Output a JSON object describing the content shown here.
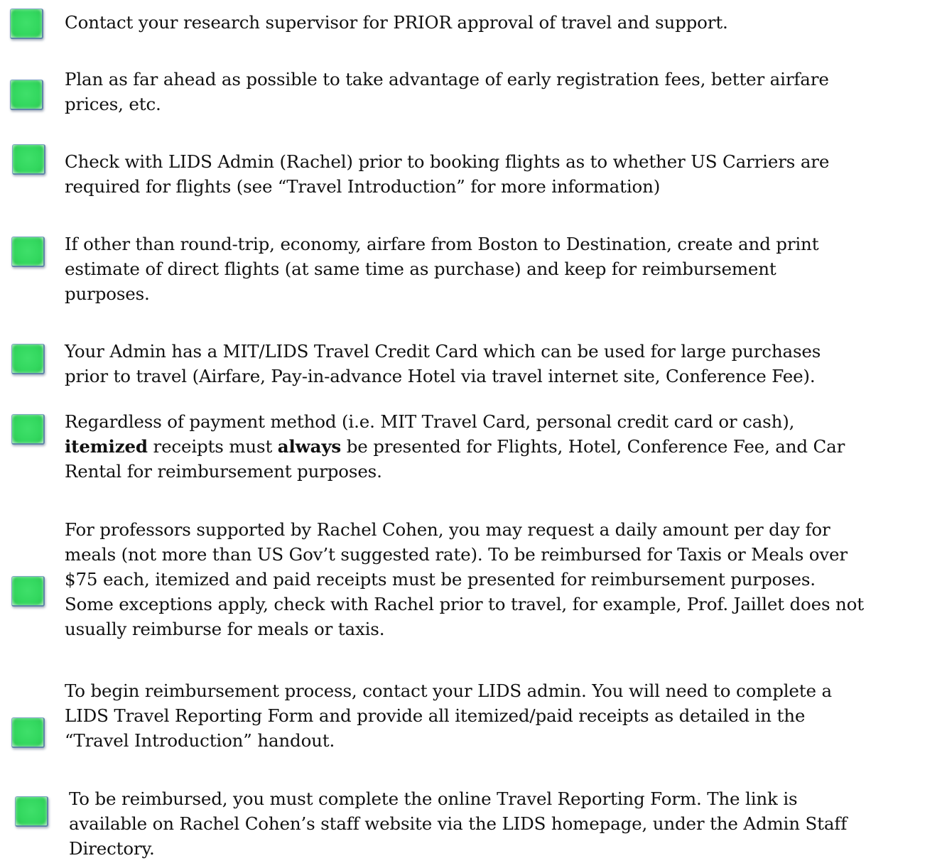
{
  "checklist": [
    {
      "lines": [
        "Contact your research supervisor for PRIOR approval of travel and support."
      ]
    },
    {
      "lines": [
        "Plan as far ahead as possible to take advantage of early registration fees, better airfare",
        "prices, etc."
      ]
    },
    {
      "lines": [
        "Check with LIDS Admin (Rachel) prior to booking flights as to whether US Carriers are",
        "required for flights (see “Travel Introduction” for more information)"
      ]
    },
    {
      "lines": [
        "If other than round-trip, economy, airfare from Boston to Destination, create and print",
        "estimate of direct flights (at same time as purchase) and keep for reimbursement",
        "purposes."
      ]
    },
    {
      "lines": [
        "Your Admin has a MIT/LIDS Travel Credit Card which can be used for large purchases",
        "prior to travel (Airfare, Pay-in-advance Hotel via travel internet site, Conference Fee)."
      ]
    },
    {
      "line1": "Regardless of payment method (i.e. MIT Travel Card, personal credit card or cash),",
      "bold1": "itemized",
      "mid": " receipts must ",
      "bold2": "always",
      "rest": " be presented for Flights, Hotel, Conference Fee, and Car",
      "line3": "Rental for reimbursement purposes."
    },
    {
      "lines": [
        "For professors supported by Rachel Cohen, you may request a daily amount per day for",
        "meals (not more than US Gov’t suggested rate). To be reimbursed for Taxis or Meals over",
        "$75 each, itemized and paid receipts must be presented for reimbursement purposes.",
        "Some exceptions apply, check with Rachel prior to travel, for example, Prof. Jaillet does not",
        "usually reimburse for meals or taxis."
      ]
    },
    {
      "lines": [
        "To begin reimbursement process, contact your LIDS admin.  You will need to complete a",
        "LIDS Travel Reporting Form and provide all itemized/paid receipts as detailed in the",
        "“Travel Introduction” handout."
      ]
    },
    {
      "lines": [
        "To be reimbursed, you must complete the online Travel Reporting Form.  The link is",
        "available on Rachel Cohen’s staff website via the LIDS homepage, under the Admin Staff",
        "Directory."
      ]
    }
  ]
}
